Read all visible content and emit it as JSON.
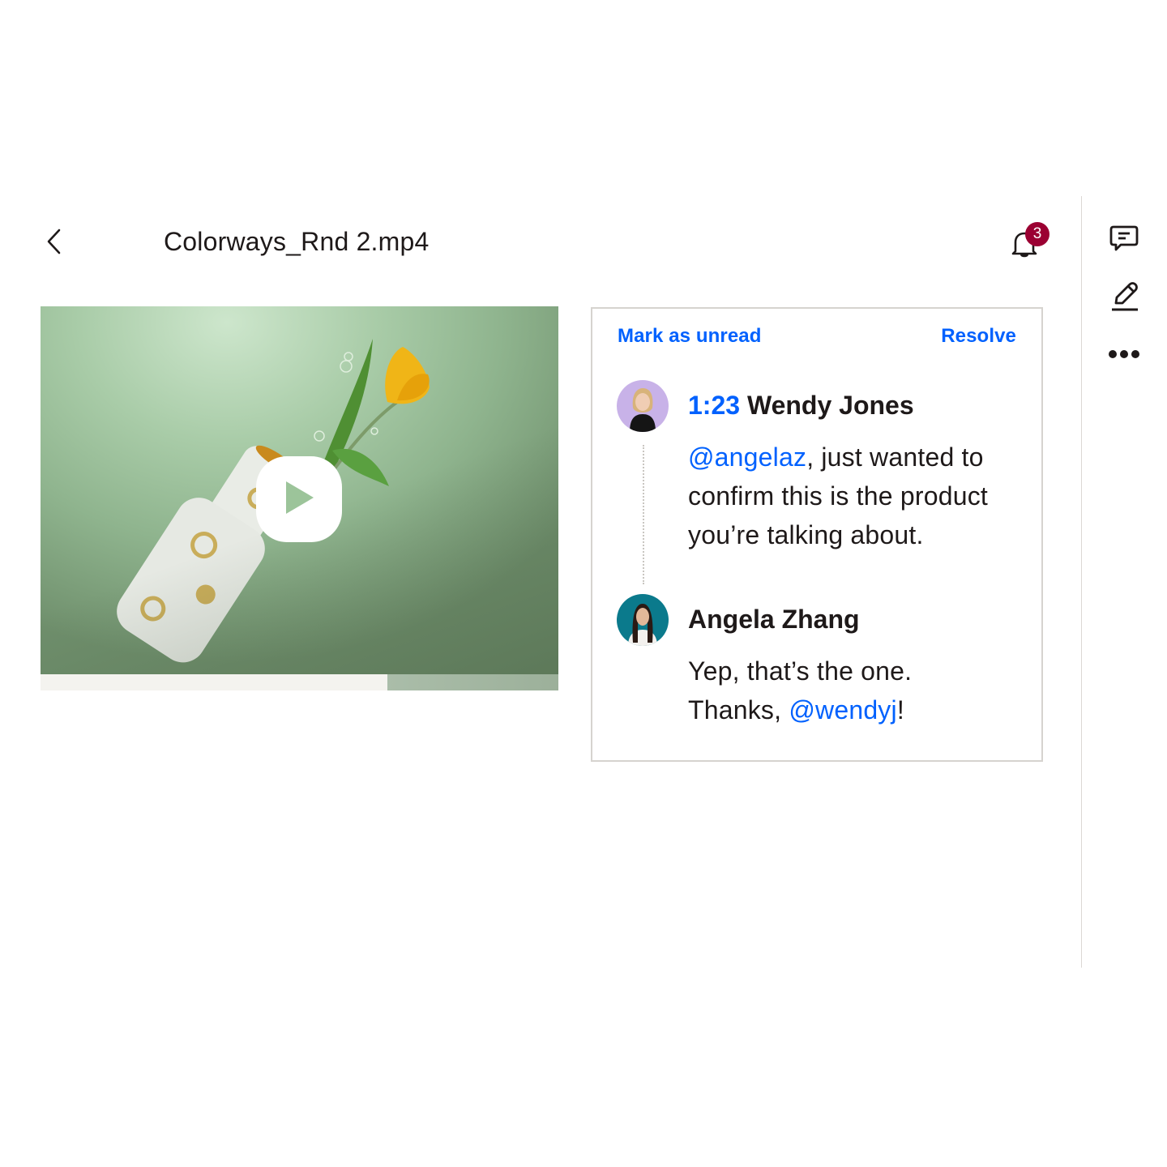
{
  "header": {
    "back_label": "Back",
    "file_title": "Colorways_Rnd 2.mp4",
    "notifications": {
      "icon": "bell-icon",
      "count": "3",
      "badge_color": "#9b0032"
    }
  },
  "rail": {
    "items": [
      {
        "icon": "comment-icon",
        "label": "Comments"
      },
      {
        "icon": "pencil-icon",
        "label": "Annotate"
      },
      {
        "icon": "more-horizontal-icon",
        "label": "More"
      }
    ]
  },
  "video": {
    "play_icon": "play-icon",
    "progress_fraction": 0.67,
    "accent_color": "#0061fe"
  },
  "comment_panel": {
    "mark_unread_label": "Mark as unread",
    "resolve_label": "Resolve",
    "comments": [
      {
        "timestamp": "1:23",
        "author": "Wendy Jones",
        "avatar_bg": "#c8b2e8",
        "mention": "@angelaz",
        "text_after_mention": ", just wanted to confirm this is the product you’re talking about."
      },
      {
        "author": "Angela Zhang",
        "avatar_bg": "#0b7a8c",
        "text_before_mention": "Yep, that’s the one. Thanks, ",
        "mention": "@wendyj",
        "text_after_mention": "!"
      }
    ]
  }
}
